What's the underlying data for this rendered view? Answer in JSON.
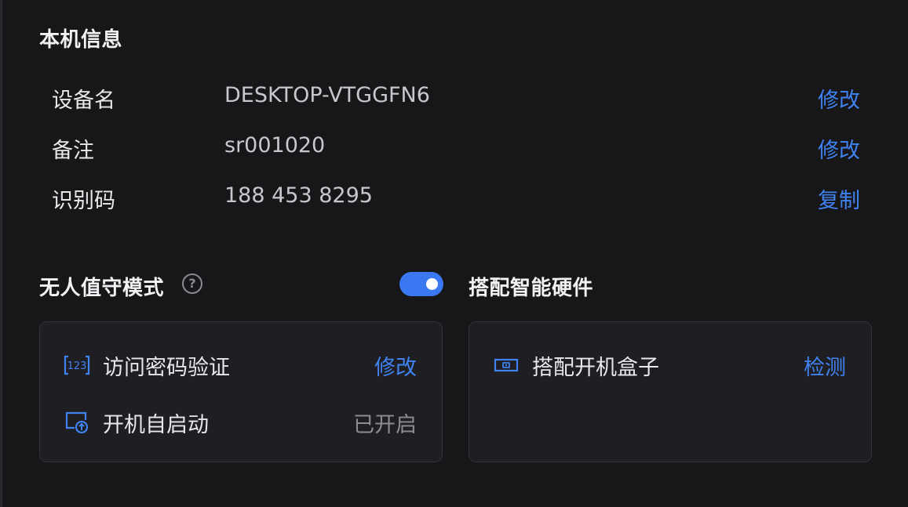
{
  "device_info": {
    "title": "本机信息",
    "rows": [
      {
        "label": "设备名",
        "value": "DESKTOP-VTGGFN6",
        "action": "修改"
      },
      {
        "label": "备注",
        "value": "sr001020",
        "action": "修改"
      },
      {
        "label": "识别码",
        "value": "188 453 8295",
        "action": "复制"
      }
    ]
  },
  "unattended": {
    "title": "无人值守模式",
    "help_icon": "?",
    "toggle_on": true,
    "items": [
      {
        "icon": "password-icon",
        "label": "访问密码验证",
        "action": "修改"
      },
      {
        "icon": "autostart-icon",
        "label": "开机自启动",
        "status": "已开启"
      }
    ]
  },
  "hardware": {
    "title": "搭配智能硬件",
    "items": [
      {
        "icon": "boot-box-icon",
        "label": "搭配开机盒子",
        "action": "检测"
      }
    ]
  },
  "colors": {
    "background": "#17171a",
    "card": "#1f1f23",
    "accent": "#3f82f0",
    "muted": "#8c8c92"
  }
}
